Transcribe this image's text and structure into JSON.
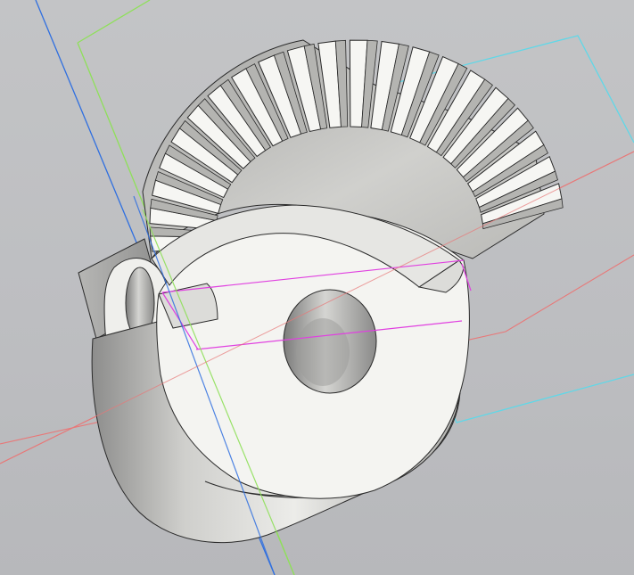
{
  "viewport": {
    "background": "#bfc0c3"
  },
  "scene": {
    "model": "spiral-bevel-gear",
    "tooth_count_visible": 21,
    "center_bore": true,
    "side_hub_with_hole": true,
    "colors": {
      "body_face": "#f4f4f1",
      "body_shade": "#d9d9d6",
      "body_dark": "#a9a9a7",
      "edge": "#2b2b2b",
      "axis_blue": "#2f6fe0",
      "axis_green": "#8fe05a",
      "plane_cyan": "#5fd8e8",
      "axis_red": "#e87878",
      "sketch_magenta": "#e040e0"
    }
  }
}
